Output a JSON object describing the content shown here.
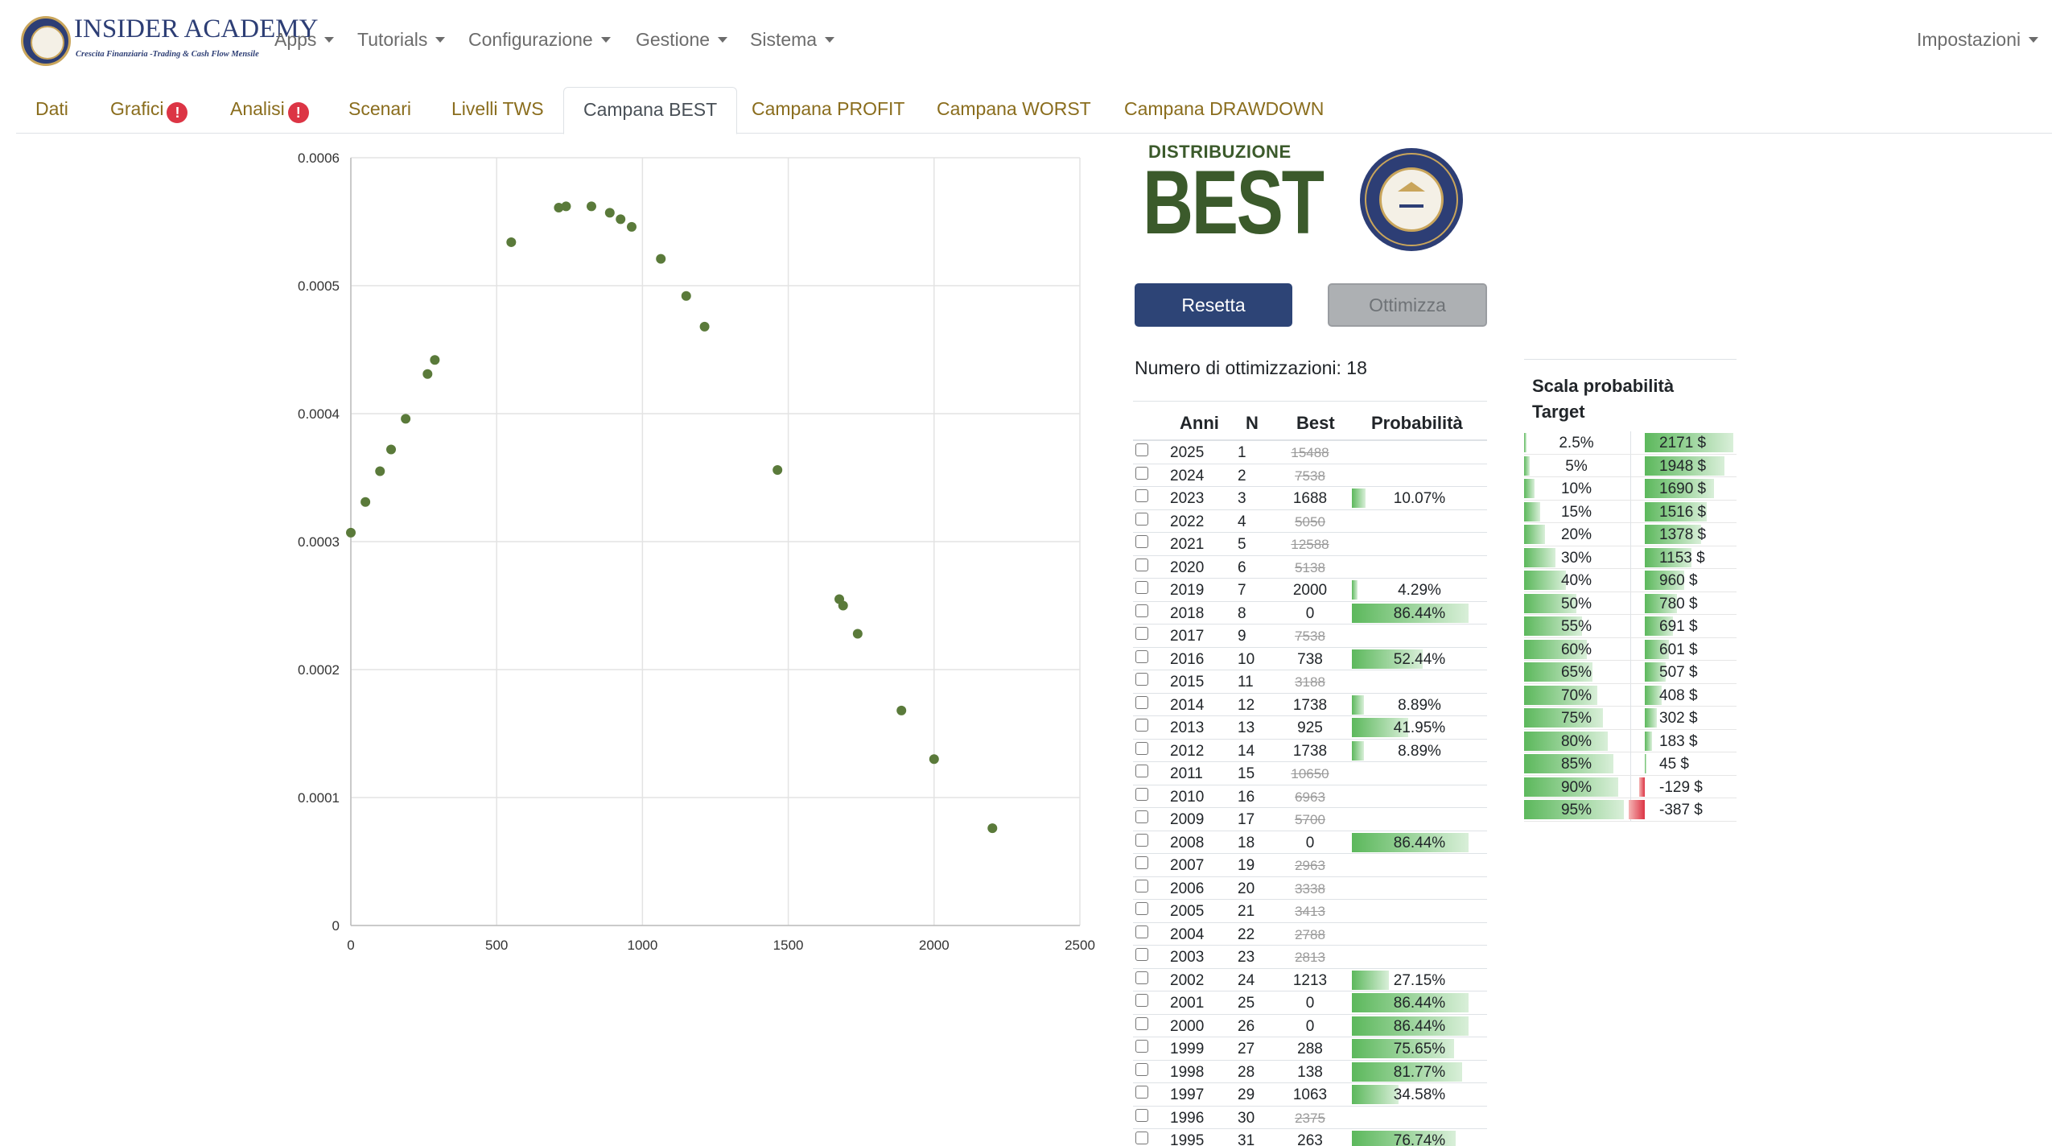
{
  "brand": {
    "title": "INSIDER ACADEMY",
    "subtitle": "Crescita Finanziaria -Trading & Cash Flow Mensile"
  },
  "nav": {
    "apps": "Apps",
    "tutorials": "Tutorials",
    "configurazione": "Configurazione",
    "gestione": "Gestione",
    "sistema": "Sistema",
    "impostazioni": "Impostazioni"
  },
  "tabs": {
    "dati": "Dati",
    "grafici": "Grafici",
    "analisi": "Analisi",
    "scenari": "Scenari",
    "livelli": "Livelli TWS",
    "best": "Campana BEST",
    "profit": "Campana PROFIT",
    "worst": "Campana WORST",
    "drawdown": "Campana DRAWDOWN",
    "alert_mark": "!"
  },
  "header": {
    "distribuzione": "DISTRIBUZIONE",
    "best": "BEST",
    "seal_text_top": "INSIDER",
    "seal_text_bottom": "ACADEMY"
  },
  "buttons": {
    "reset": "Resetta",
    "optimize": "Ottimizza"
  },
  "optimizations_label": "Numero di ottimizzazioni: 18",
  "table": {
    "headers": {
      "anni": "Anni",
      "n": "N",
      "best": "Best",
      "prob": "Probabilità"
    },
    "rows": [
      {
        "year": "2025",
        "n": "1",
        "best": "15488",
        "strike": true,
        "prob": "",
        "pv": 0
      },
      {
        "year": "2024",
        "n": "2",
        "best": "7538",
        "strike": true,
        "prob": "",
        "pv": 0
      },
      {
        "year": "2023",
        "n": "3",
        "best": "1688",
        "strike": false,
        "prob": "10.07%",
        "pv": 0.1007
      },
      {
        "year": "2022",
        "n": "4",
        "best": "5050",
        "strike": true,
        "prob": "",
        "pv": 0
      },
      {
        "year": "2021",
        "n": "5",
        "best": "12588",
        "strike": true,
        "prob": "",
        "pv": 0
      },
      {
        "year": "2020",
        "n": "6",
        "best": "5138",
        "strike": true,
        "prob": "",
        "pv": 0
      },
      {
        "year": "2019",
        "n": "7",
        "best": "2000",
        "strike": false,
        "prob": "4.29%",
        "pv": 0.0429
      },
      {
        "year": "2018",
        "n": "8",
        "best": "0",
        "strike": false,
        "prob": "86.44%",
        "pv": 0.8644
      },
      {
        "year": "2017",
        "n": "9",
        "best": "7538",
        "strike": true,
        "prob": "",
        "pv": 0
      },
      {
        "year": "2016",
        "n": "10",
        "best": "738",
        "strike": false,
        "prob": "52.44%",
        "pv": 0.5244
      },
      {
        "year": "2015",
        "n": "11",
        "best": "3188",
        "strike": true,
        "prob": "",
        "pv": 0
      },
      {
        "year": "2014",
        "n": "12",
        "best": "1738",
        "strike": false,
        "prob": "8.89%",
        "pv": 0.0889
      },
      {
        "year": "2013",
        "n": "13",
        "best": "925",
        "strike": false,
        "prob": "41.95%",
        "pv": 0.4195
      },
      {
        "year": "2012",
        "n": "14",
        "best": "1738",
        "strike": false,
        "prob": "8.89%",
        "pv": 0.0889
      },
      {
        "year": "2011",
        "n": "15",
        "best": "10650",
        "strike": true,
        "prob": "",
        "pv": 0
      },
      {
        "year": "2010",
        "n": "16",
        "best": "6963",
        "strike": true,
        "prob": "",
        "pv": 0
      },
      {
        "year": "2009",
        "n": "17",
        "best": "5700",
        "strike": true,
        "prob": "",
        "pv": 0
      },
      {
        "year": "2008",
        "n": "18",
        "best": "0",
        "strike": false,
        "prob": "86.44%",
        "pv": 0.8644
      },
      {
        "year": "2007",
        "n": "19",
        "best": "2963",
        "strike": true,
        "prob": "",
        "pv": 0
      },
      {
        "year": "2006",
        "n": "20",
        "best": "3338",
        "strike": true,
        "prob": "",
        "pv": 0
      },
      {
        "year": "2005",
        "n": "21",
        "best": "3413",
        "strike": true,
        "prob": "",
        "pv": 0
      },
      {
        "year": "2004",
        "n": "22",
        "best": "2788",
        "strike": true,
        "prob": "",
        "pv": 0
      },
      {
        "year": "2003",
        "n": "23",
        "best": "2813",
        "strike": true,
        "prob": "",
        "pv": 0
      },
      {
        "year": "2002",
        "n": "24",
        "best": "1213",
        "strike": false,
        "prob": "27.15%",
        "pv": 0.2715
      },
      {
        "year": "2001",
        "n": "25",
        "best": "0",
        "strike": false,
        "prob": "86.44%",
        "pv": 0.8644
      },
      {
        "year": "2000",
        "n": "26",
        "best": "0",
        "strike": false,
        "prob": "86.44%",
        "pv": 0.8644
      },
      {
        "year": "1999",
        "n": "27",
        "best": "288",
        "strike": false,
        "prob": "75.65%",
        "pv": 0.7565
      },
      {
        "year": "1998",
        "n": "28",
        "best": "138",
        "strike": false,
        "prob": "81.77%",
        "pv": 0.8177
      },
      {
        "year": "1997",
        "n": "29",
        "best": "1063",
        "strike": false,
        "prob": "34.58%",
        "pv": 0.3458
      },
      {
        "year": "1996",
        "n": "30",
        "best": "2375",
        "strike": true,
        "prob": "",
        "pv": 0
      },
      {
        "year": "1995",
        "n": "31",
        "best": "263",
        "strike": false,
        "prob": "76.74%",
        "pv": 0.7674
      }
    ]
  },
  "scale": {
    "title_line1": "Scala probabilità",
    "title_line2": "Target",
    "rows": [
      {
        "pct": "2.5%",
        "p": 0.025,
        "value": "2171 $",
        "v": 2171
      },
      {
        "pct": "5%",
        "p": 0.05,
        "value": "1948 $",
        "v": 1948
      },
      {
        "pct": "10%",
        "p": 0.1,
        "value": "1690 $",
        "v": 1690
      },
      {
        "pct": "15%",
        "p": 0.15,
        "value": "1516 $",
        "v": 1516
      },
      {
        "pct": "20%",
        "p": 0.2,
        "value": "1378 $",
        "v": 1378
      },
      {
        "pct": "30%",
        "p": 0.3,
        "value": "1153 $",
        "v": 1153
      },
      {
        "pct": "40%",
        "p": 0.4,
        "value": "960 $",
        "v": 960
      },
      {
        "pct": "50%",
        "p": 0.5,
        "value": "780 $",
        "v": 780
      },
      {
        "pct": "55%",
        "p": 0.55,
        "value": "691 $",
        "v": 691
      },
      {
        "pct": "60%",
        "p": 0.6,
        "value": "601 $",
        "v": 601
      },
      {
        "pct": "65%",
        "p": 0.65,
        "value": "507 $",
        "v": 507
      },
      {
        "pct": "70%",
        "p": 0.7,
        "value": "408 $",
        "v": 408
      },
      {
        "pct": "75%",
        "p": 0.75,
        "value": "302 $",
        "v": 302
      },
      {
        "pct": "80%",
        "p": 0.8,
        "value": "183 $",
        "v": 183
      },
      {
        "pct": "85%",
        "p": 0.85,
        "value": "45 $",
        "v": 45
      },
      {
        "pct": "90%",
        "p": 0.9,
        "value": "-129 $",
        "v": -129
      },
      {
        "pct": "95%",
        "p": 0.95,
        "value": "-387 $",
        "v": -387
      }
    ]
  },
  "colors": {
    "point": "#5a7a3a",
    "accent": "#2d4476",
    "tab_link": "#8a6d1d",
    "bar_green": "#5cb85c",
    "bar_red": "#dc3545"
  },
  "chart_data": {
    "type": "scatter",
    "xlim": [
      0,
      2500
    ],
    "ylim": [
      0,
      0.0006
    ],
    "x_ticks": [
      "0",
      "500",
      "1000",
      "1500",
      "2000",
      "2500"
    ],
    "y_ticks": [
      "0",
      "0.0001",
      "0.0002",
      "0.0003",
      "0.0004",
      "0.0005",
      "0.0006"
    ],
    "grid": true,
    "points": [
      [
        0,
        0.000307
      ],
      [
        50,
        0.000331
      ],
      [
        100,
        0.000355
      ],
      [
        138,
        0.000372
      ],
      [
        188,
        0.000396
      ],
      [
        263,
        0.000431
      ],
      [
        288,
        0.000442
      ],
      [
        550,
        0.000534
      ],
      [
        713,
        0.000561
      ],
      [
        738,
        0.000562
      ],
      [
        825,
        0.000562
      ],
      [
        888,
        0.000557
      ],
      [
        925,
        0.000552
      ],
      [
        963,
        0.000546
      ],
      [
        1063,
        0.000521
      ],
      [
        1150,
        0.000492
      ],
      [
        1213,
        0.000468
      ],
      [
        1463,
        0.000356
      ],
      [
        1675,
        0.000255
      ],
      [
        1688,
        0.00025
      ],
      [
        1738,
        0.000228
      ],
      [
        1888,
        0.000168
      ],
      [
        2000,
        0.00013
      ],
      [
        2200,
        7.6e-05
      ]
    ]
  }
}
